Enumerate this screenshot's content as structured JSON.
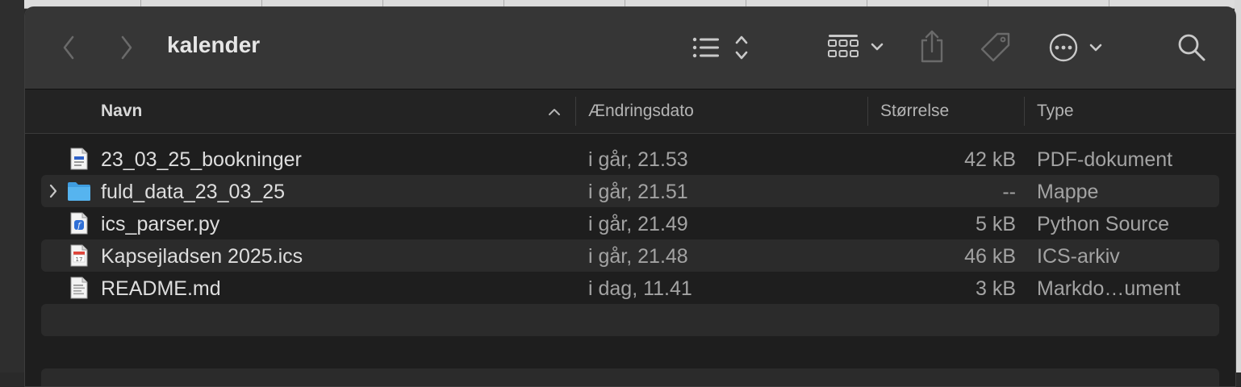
{
  "window": {
    "title": "kalender"
  },
  "toolbar": {
    "back": "chevron-left-icon",
    "forward": "chevron-right-icon",
    "view_list": "list-view-icon",
    "view_group": "grid-group-icon",
    "share": "share-icon",
    "tag": "tag-icon",
    "more": "ellipsis-circle-icon",
    "search": "search-icon"
  },
  "columns": {
    "name": "Navn",
    "date": "Ændringsdato",
    "size": "Størrelse",
    "type": "Type"
  },
  "files": [
    {
      "name": "23_03_25_bookninger",
      "date": "i går, 21.53",
      "size": "42 kB",
      "type": "PDF-dokument",
      "icon": "pdf-icon"
    },
    {
      "name": "fuld_data_23_03_25",
      "date": "i går, 21.51",
      "size": "--",
      "type": "Mappe",
      "icon": "folder-icon"
    },
    {
      "name": "ics_parser.py",
      "date": "i går, 21.49",
      "size": "5 kB",
      "type": "Python Source",
      "icon": "python-icon"
    },
    {
      "name": "Kapsejladsen 2025.ics",
      "date": "i går, 21.48",
      "size": "46 kB",
      "type": "ICS-arkiv",
      "icon": "calendar-icon"
    },
    {
      "name": "README.md",
      "date": "i dag, 11.41",
      "size": "3 kB",
      "type": "Markdo…ument",
      "icon": "markdown-icon"
    }
  ],
  "colors": {
    "accent_folder": "#56b4ef",
    "row_alt": "#2b2b2b",
    "toolbar": "#363636"
  }
}
